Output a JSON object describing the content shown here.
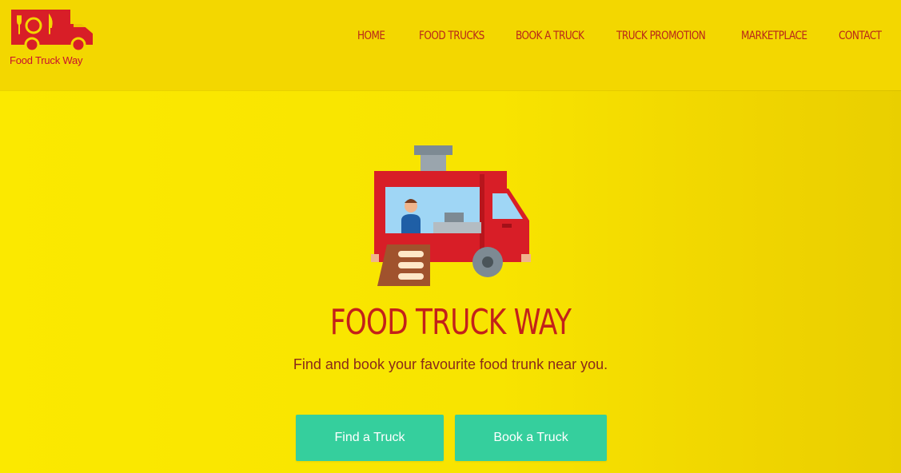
{
  "brand": {
    "name": "Food Truck Way",
    "primary_color": "#c8102e",
    "background_color": "#f7e400",
    "button_color": "#35cf9d"
  },
  "nav": {
    "items": [
      {
        "label": "HOME"
      },
      {
        "label": "FOOD TRUCKS"
      },
      {
        "label": "BOOK A TRUCK"
      },
      {
        "label": "TRUCK PROMOTION"
      },
      {
        "label": "MARKETPLACE"
      },
      {
        "label": "CONTACT"
      }
    ]
  },
  "hero": {
    "title": "FOOD TRUCK WAY",
    "subtitle": "Find and book your favourite food trunk near you.",
    "illustration_icon": "food-truck-icon",
    "buttons": {
      "find_label": "Find a Truck",
      "book_label": "Book a Truck"
    }
  }
}
